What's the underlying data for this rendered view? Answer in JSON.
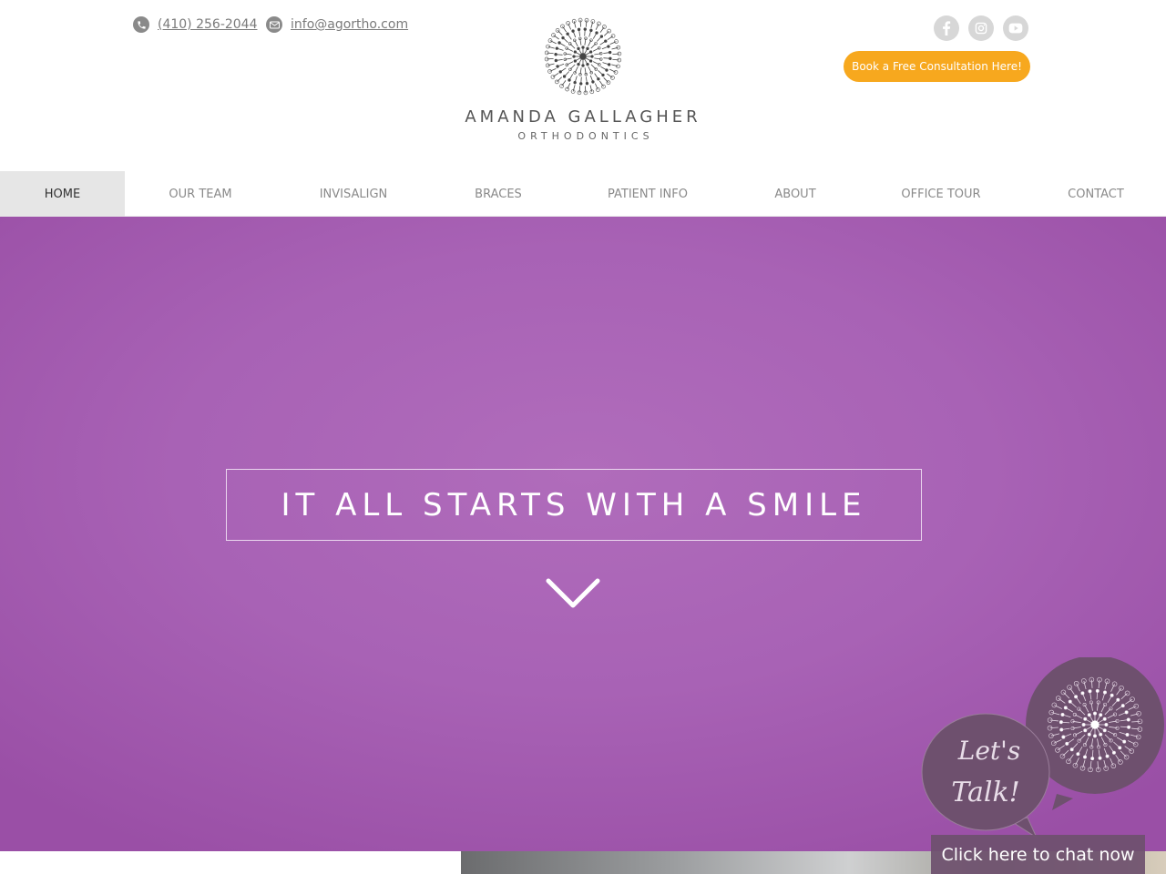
{
  "header": {
    "phone": "(410) 256-2044",
    "email": "info@agortho.com",
    "logo_name": "AMANDA GALLAGHER",
    "logo_sub": "ORTHODONTICS",
    "cta_label": "Book a Free Consultation Here!",
    "social": [
      "facebook-icon",
      "instagram-icon",
      "youtube-icon"
    ]
  },
  "nav": {
    "items": [
      {
        "label": "HOME",
        "active": true
      },
      {
        "label": "OUR TEAM"
      },
      {
        "label": "INVISALIGN"
      },
      {
        "label": "BRACES"
      },
      {
        "label": "PATIENT INFO"
      },
      {
        "label": "ABOUT"
      },
      {
        "label": "OFFICE TOUR"
      },
      {
        "label": "CONTACT"
      }
    ]
  },
  "hero": {
    "headline": "IT ALL STARTS WITH A SMILE",
    "background": "#a862b5"
  },
  "chat": {
    "bubble_text_1": "Let's",
    "bubble_text_2": "Talk!",
    "button_label": "Click here to chat now"
  },
  "colors": {
    "accent": "#f7a81e",
    "brand_purple": "#a862b5",
    "chat_purple": "#6e506e"
  }
}
